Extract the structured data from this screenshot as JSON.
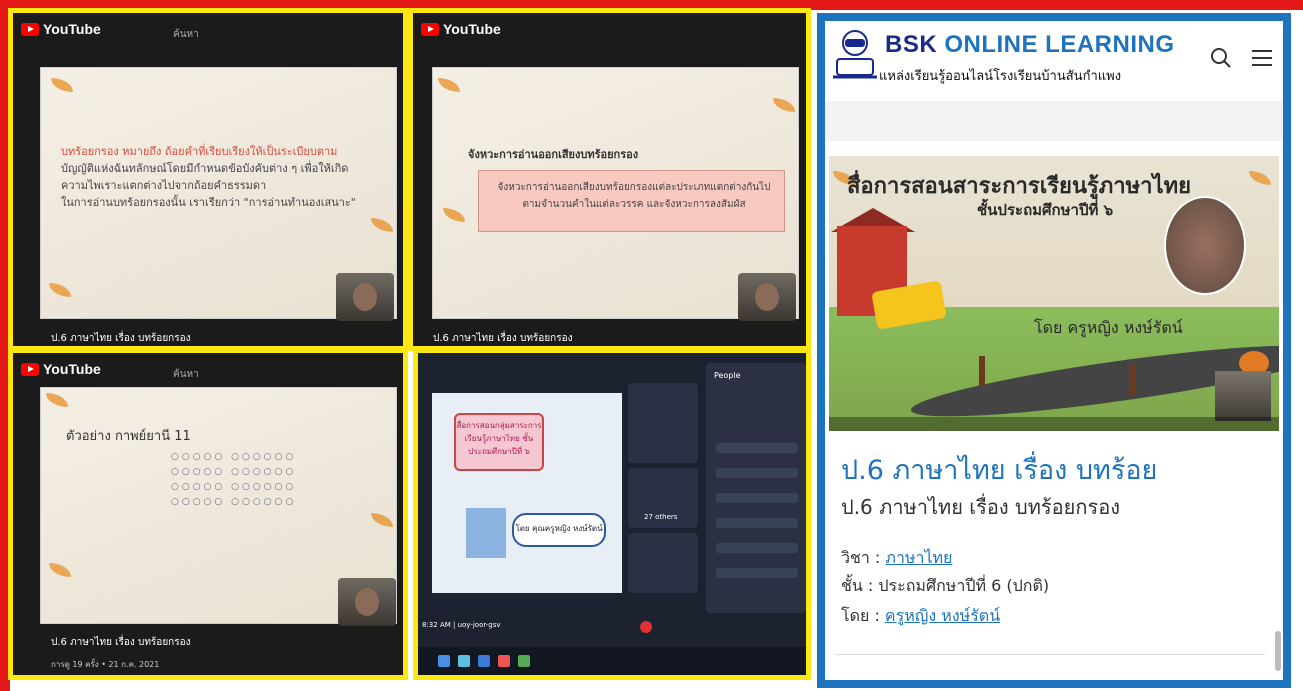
{
  "photos": {
    "yt_label": "YouTube",
    "search_label": "ค้นหา",
    "slide1": {
      "lines": [
        "บทร้อยกรอง หมายถึง ถ้อยคำที่เรียบเรียงให้เป็นระเบียบตาม",
        "บัญญัติแห่งฉันทลักษณ์โดยมีกำหนดข้อบังคับต่าง ๆ เพื่อให้เกิด",
        "ความไพเราะแตกต่างไปจากถ้อยคำธรรมดา",
        "ในการอ่านบทร้อยกรองนั้น เราเรียกว่า \"การอ่านทำนองเสนาะ\""
      ],
      "caption": "ป.6 ภาษาไทย เรื่อง บทร้อยกรอง"
    },
    "slide2": {
      "heading": "จังหวะการอ่านออกเสียงบทร้อยกรอง",
      "box_lines": [
        "จังหวะการอ่านออกเสียงบทร้อยกรองแต่ละประเภทแตกต่างกันไป",
        "ตามจำนวนคำในแต่ละวรรค และจังหวะการลงสัมผัส"
      ],
      "caption": "ป.6 ภาษาไทย เรื่อง บทร้อยกรอง"
    },
    "slide3": {
      "heading": "ตัวอย่าง กาพย์ยานี 11",
      "dots": [
        "○○○○○ ○○○○○○",
        "○○○○○ ○○○○○○",
        "○○○○○ ○○○○○○",
        "○○○○○ ○○○○○○"
      ],
      "caption": "ป.6 ภาษาไทย เรื่อง บทร้อยกรอง",
      "views": "การดู 19 ครั้ง • 21 ก.ค. 2021"
    },
    "teams": {
      "slide_title": "สื่อการสอนกลุ่มสาระการเรียนรู้ภาษาไทย ชั้นประถมศึกษาปีที่ ๖",
      "by": "โดย คุณครูหญิง หงษ์รัตน์",
      "people_label": "People",
      "others": "27 others",
      "time": "8:32 AM | uoy-joor-gsv"
    }
  },
  "site": {
    "title_a": "BSK",
    "title_b": " ONLINE LEARNING",
    "subtitle": "แหล่งเรียนรู้ออนไลน์โรงเรียนบ้านสันกำแพง",
    "search_icon": "search-icon",
    "menu_icon": "menu-icon"
  },
  "video": {
    "title": "สื่อการสอนสาระการเรียนรู้ภาษาไทย",
    "subtitle": "ชั้นประถมศึกษาปีที่ ๖",
    "by": "โดย ครูหญิง หงษ์รัตน์"
  },
  "post": {
    "title": "ป.6 ภาษาไทย เรื่อง บทร้อย",
    "subtitle": "ป.6 ภาษาไทย เรื่อง บทร้อยกรอง",
    "subject_label": "วิชา : ",
    "subject": "ภาษาไทย",
    "grade_label": "ชั้น : ประถมศึกษาปีที่ 6 (ปกติ)",
    "by_label": "โดย : ",
    "author": "ครูหญิง หงษ์รัตน์"
  }
}
